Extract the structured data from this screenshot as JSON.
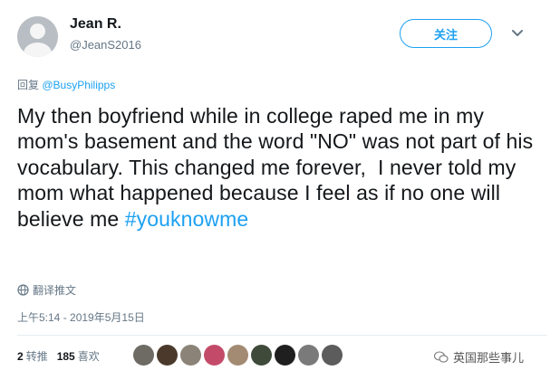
{
  "user": {
    "name": "Jean R.",
    "handle": "@JeanS2016"
  },
  "follow_label": "关注",
  "reply": {
    "prefix": "回复 ",
    "mention": "@BusyPhilipps"
  },
  "tweet": {
    "text": "My then boyfriend while in college raped me in my mom's basement and the word \"NO\" was not part of his vocabulary. This changed me forever,  I never told my mom what happened because I feel as if no one will believe me ",
    "hashtag": "#youknowme"
  },
  "translate_label": "翻译推文",
  "timestamp": "上午5:14 - 2019年5月15日",
  "stats": {
    "retweets": "2",
    "retweets_label": "转推",
    "likes": "185",
    "likes_label": "喜欢"
  },
  "liker_avatars": [
    {
      "name": "liker-avatar-1",
      "color": "#6e6a64"
    },
    {
      "name": "liker-avatar-2",
      "color": "#4b3a2c"
    },
    {
      "name": "liker-avatar-3",
      "color": "#8b8378"
    },
    {
      "name": "liker-avatar-4",
      "color": "#c44a6a"
    },
    {
      "name": "liker-avatar-5",
      "color": "#a38a72"
    },
    {
      "name": "liker-avatar-6",
      "color": "#3f4a3a"
    },
    {
      "name": "liker-avatar-7",
      "color": "#1f1f1f"
    },
    {
      "name": "liker-avatar-8",
      "color": "#7a7a7a"
    },
    {
      "name": "liker-avatar-9",
      "color": "#5c5c5c"
    }
  ],
  "watermark": "英国那些事儿",
  "colors": {
    "accent": "#1da1f2",
    "muted": "#657786",
    "text": "#14171a"
  }
}
